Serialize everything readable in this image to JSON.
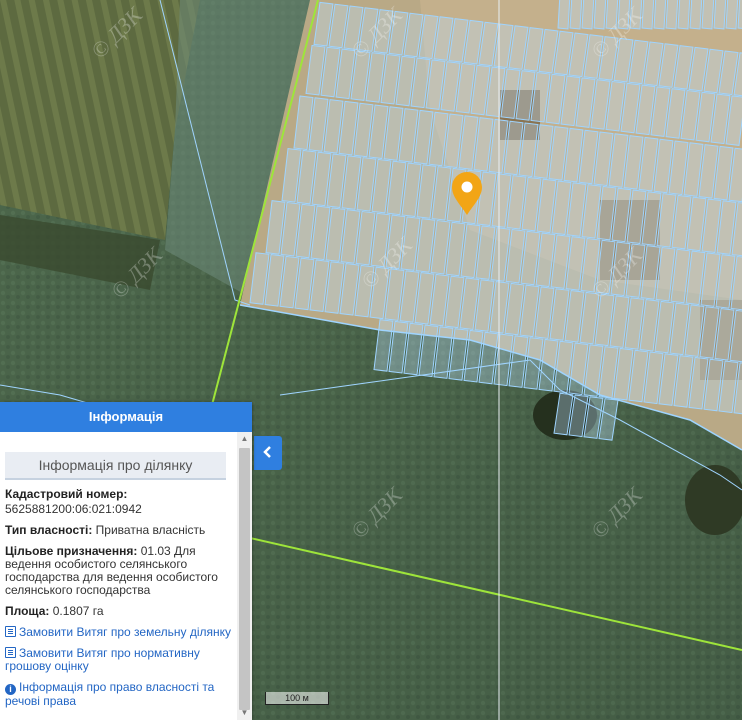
{
  "map": {
    "watermark": "© ДЗК",
    "scale_label": "100 м",
    "colors": {
      "parcel_stroke": "#9fd4ff",
      "parcel_fill": "#bfe3ff",
      "boundary_line": "#9ee53a",
      "marker": "#f2a516"
    }
  },
  "panel": {
    "header": "Інформація",
    "section_title": "Інформація про ділянку",
    "cadastral_label": "Кадастровий номер:",
    "cadastral_value": "5625881200:06:021:0942",
    "ownership_label": "Тип власності:",
    "ownership_value": "Приватна власність",
    "purpose_label": "Цільове призначення:",
    "purpose_value": "01.03 Для ведення особистого селянського господарства для ведення особистого селянського господарства",
    "area_label": "Площа:",
    "area_value": "0.1807 га",
    "link_extract": "Замовити Витяг про земельну ділянку",
    "link_valuation": "Замовити Витяг про нормативну грошову оцінку",
    "link_rights": "Інформація про право власності та речові права"
  },
  "icons": {
    "collapse": "chevron-left-icon",
    "marker": "map-pin-icon",
    "document": "document-icon",
    "info": "info-icon"
  }
}
